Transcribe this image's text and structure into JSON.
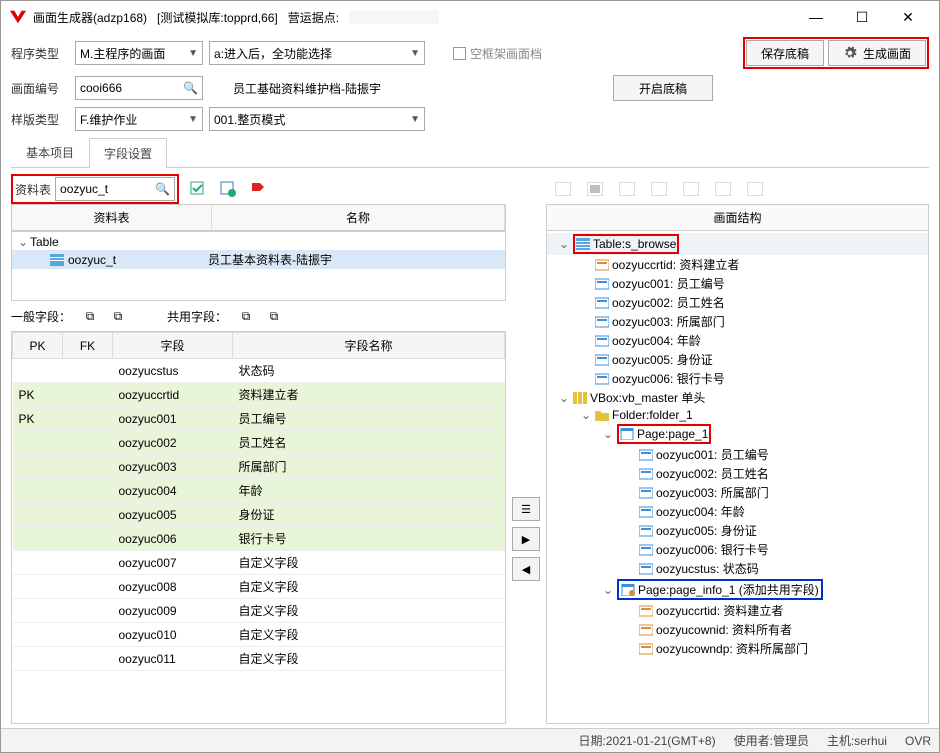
{
  "title": {
    "app": "画面生成器(adzp168)",
    "db": "[测试模拟库:topprd,66]",
    "site_label": "营运据点:"
  },
  "winbtn": {
    "min": "—",
    "max": "☐",
    "close": "✕"
  },
  "row1": {
    "prog_type_label": "程序类型",
    "prog_type_value": "M.主程序的画面",
    "action_value": "a:进入后，全功能选择",
    "frame_check": "空框架画面档",
    "save": "保存底稿",
    "gen": "生成画面"
  },
  "row2": {
    "scr_no_label": "画面编号",
    "scr_no_value": "cooi666",
    "doc_title": "员工基础资料维护档-陆振宇",
    "open": "开启底稿"
  },
  "row3": {
    "tpl_type_label": "样版类型",
    "tpl_type_value": "F.维护作业",
    "mode_value": "001.整页模式"
  },
  "tabs": {
    "basic": "基本项目",
    "fields": "字段设置"
  },
  "left": {
    "table_label": "资料表",
    "table_value": "oozyuc_t",
    "grid_head": {
      "table": "资料表",
      "name": "名称"
    },
    "tree": {
      "root": "Table",
      "item_table": "oozyuc_t",
      "item_name": "员工基本资料表-陆振宇"
    },
    "normal_label": "一般字段：",
    "shared_label": "共用字段：",
    "cols": {
      "pk": "PK",
      "fk": "FK",
      "field": "字段",
      "name": "字段名称"
    },
    "rows": [
      {
        "pk": "",
        "fk": "",
        "field": "oozyucstus",
        "name": "状态码",
        "hl": false
      },
      {
        "pk": "PK",
        "fk": "",
        "field": "oozyuccrtid",
        "name": "资料建立者",
        "hl": true
      },
      {
        "pk": "PK",
        "fk": "",
        "field": "oozyuc001",
        "name": "员工编号",
        "hl": true
      },
      {
        "pk": "",
        "fk": "",
        "field": "oozyuc002",
        "name": "员工姓名",
        "hl": true
      },
      {
        "pk": "",
        "fk": "",
        "field": "oozyuc003",
        "name": "所属部门",
        "hl": true
      },
      {
        "pk": "",
        "fk": "",
        "field": "oozyuc004",
        "name": "年龄",
        "hl": true
      },
      {
        "pk": "",
        "fk": "",
        "field": "oozyuc005",
        "name": "身份证",
        "hl": true
      },
      {
        "pk": "",
        "fk": "",
        "field": "oozyuc006",
        "name": "银行卡号",
        "hl": true
      },
      {
        "pk": "",
        "fk": "",
        "field": "oozyuc007",
        "name": "自定义字段",
        "hl": false
      },
      {
        "pk": "",
        "fk": "",
        "field": "oozyuc008",
        "name": "自定义字段",
        "hl": false
      },
      {
        "pk": "",
        "fk": "",
        "field": "oozyuc009",
        "name": "自定义字段",
        "hl": false
      },
      {
        "pk": "",
        "fk": "",
        "field": "oozyuc010",
        "name": "自定义字段",
        "hl": false
      },
      {
        "pk": "",
        "fk": "",
        "field": "oozyuc011",
        "name": "自定义字段",
        "hl": false
      }
    ]
  },
  "mid": {
    "list": "☰",
    "right": "▶",
    "left": "◀"
  },
  "right": {
    "head": "画面结构",
    "nodes": [
      {
        "depth": 0,
        "toggle": "v",
        "icon": "table",
        "text": "Table:s_browse",
        "box": "red",
        "sel": true
      },
      {
        "depth": 1,
        "icon": "field-s",
        "text": "oozyuccrtid: 资料建立者"
      },
      {
        "depth": 1,
        "icon": "field",
        "text": "oozyuc001: 员工编号"
      },
      {
        "depth": 1,
        "icon": "field",
        "text": "oozyuc002: 员工姓名"
      },
      {
        "depth": 1,
        "icon": "field",
        "text": "oozyuc003: 所属部门"
      },
      {
        "depth": 1,
        "icon": "field",
        "text": "oozyuc004: 年龄"
      },
      {
        "depth": 1,
        "icon": "field",
        "text": "oozyuc005: 身份证"
      },
      {
        "depth": 1,
        "icon": "field",
        "text": "oozyuc006: 银行卡号"
      },
      {
        "depth": 0,
        "toggle": "v",
        "icon": "vbox",
        "text": "VBox:vb_master 单头"
      },
      {
        "depth": 1,
        "toggle": "v",
        "icon": "folder",
        "text": "Folder:folder_1"
      },
      {
        "depth": 2,
        "toggle": "v",
        "icon": "page",
        "text": "Page:page_1",
        "box": "red"
      },
      {
        "depth": 3,
        "icon": "field",
        "text": "oozyuc001: 员工编号"
      },
      {
        "depth": 3,
        "icon": "field",
        "text": "oozyuc002: 员工姓名"
      },
      {
        "depth": 3,
        "icon": "field",
        "text": "oozyuc003: 所属部门"
      },
      {
        "depth": 3,
        "icon": "field",
        "text": "oozyuc004: 年龄"
      },
      {
        "depth": 3,
        "icon": "field",
        "text": "oozyuc005: 身份证"
      },
      {
        "depth": 3,
        "icon": "field",
        "text": "oozyuc006: 银行卡号"
      },
      {
        "depth": 3,
        "icon": "field",
        "text": "oozyucstus: 状态码"
      },
      {
        "depth": 2,
        "toggle": "v",
        "icon": "page-s",
        "text": "Page:page_info_1 (添加共用字段)",
        "box": "blue"
      },
      {
        "depth": 3,
        "icon": "field-s",
        "text": "oozyuccrtid: 资料建立者"
      },
      {
        "depth": 3,
        "icon": "field-s",
        "text": "oozyucownid: 资料所有者"
      },
      {
        "depth": 3,
        "icon": "field-s",
        "text": "oozyucowndp: 资料所属部门"
      }
    ]
  },
  "status": {
    "date": "日期:2021-01-21(GMT+8)",
    "user": "使用者:管理员",
    "host": "主机:serhui",
    "ovr": "OVR"
  }
}
